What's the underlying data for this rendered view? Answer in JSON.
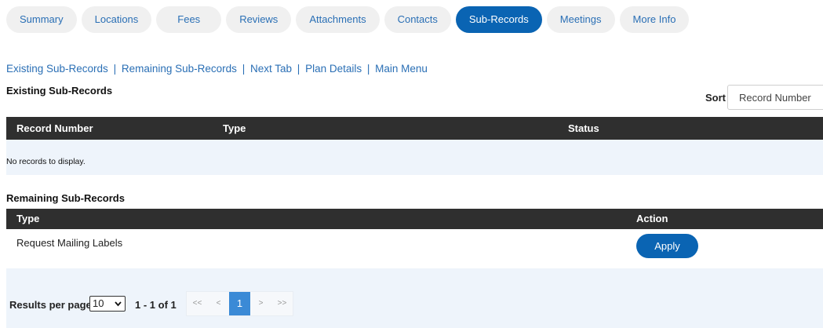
{
  "tabs": [
    "Summary",
    "Locations",
    "Fees",
    "Reviews",
    "Attachments",
    "Contacts",
    "Sub-Records",
    "Meetings",
    "More Info"
  ],
  "active_tab": "Sub-Records",
  "links": {
    "existing": "Existing Sub-Records",
    "remaining": "Remaining Sub-Records",
    "next_tab": "Next Tab",
    "plan_details": "Plan Details",
    "main_menu": "Main Menu",
    "separator": "|"
  },
  "existing": {
    "title": "Existing Sub-Records",
    "sort_label": "Sort",
    "sort_value": "Record Number",
    "headers": {
      "record_number": "Record Number",
      "type": "Type",
      "status": "Status"
    },
    "empty_message": "No records to display."
  },
  "remaining": {
    "title": "Remaining Sub-Records",
    "headers": {
      "type": "Type",
      "action": "Action"
    },
    "rows": [
      {
        "type": "Request Mailing Labels",
        "action": "Apply"
      }
    ]
  },
  "pagination": {
    "results_label": "Results per page",
    "per_page": "10",
    "range": "1 - 1 of 1",
    "first": "<<",
    "prev": "<",
    "current": "1",
    "next": ">",
    "last": ">>"
  }
}
